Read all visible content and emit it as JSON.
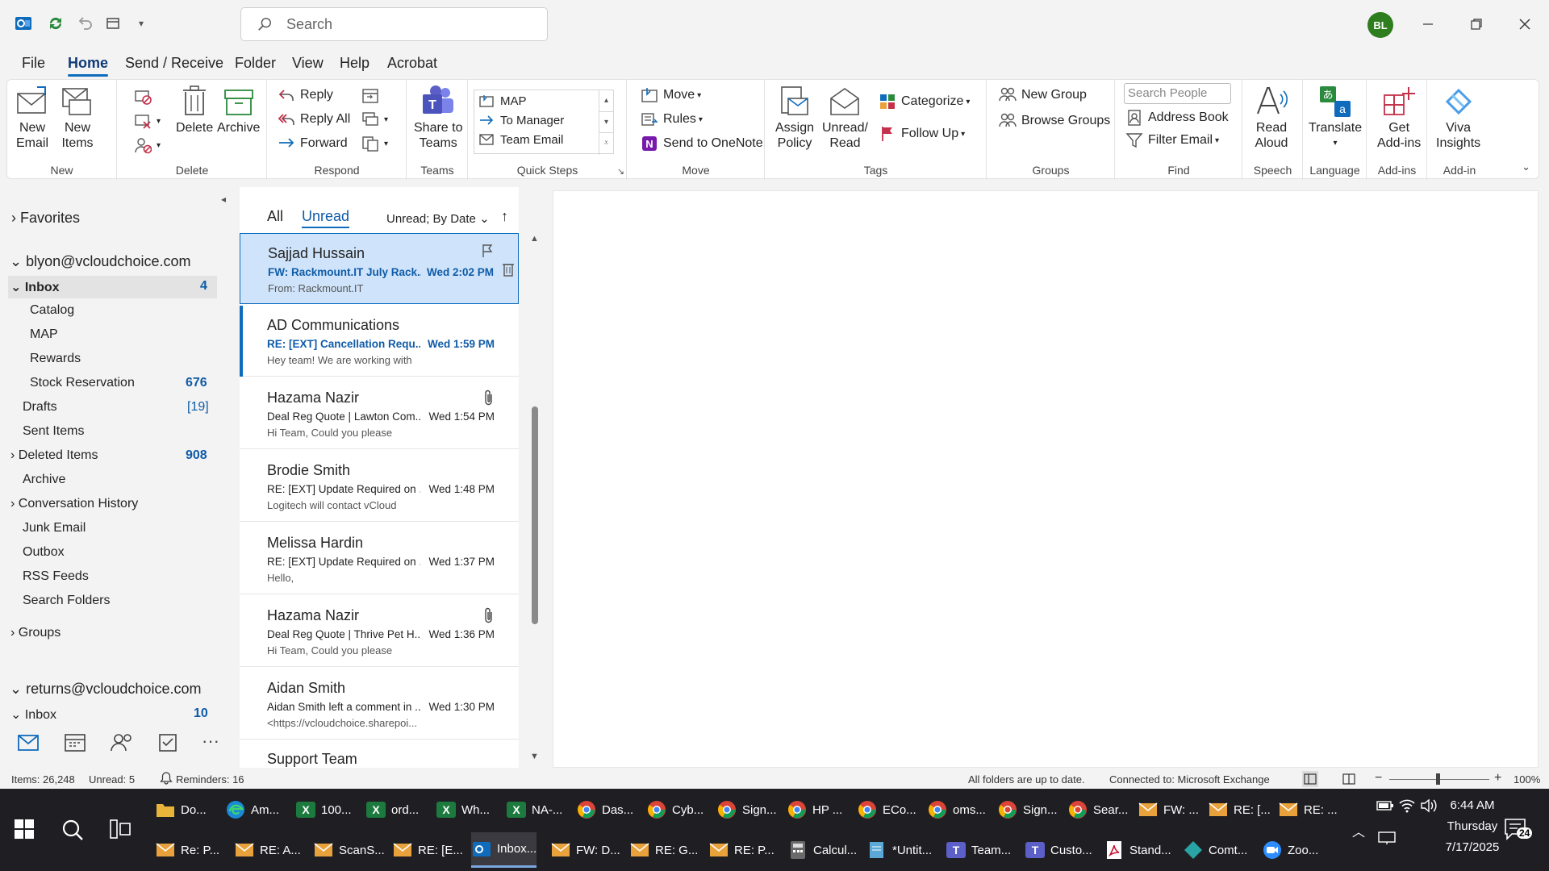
{
  "title_bar": {
    "search_placeholder": "Search",
    "avatar_initials": "BL"
  },
  "menu_tabs": [
    "File",
    "Home",
    "Send / Receive",
    "Folder",
    "View",
    "Help",
    "Acrobat"
  ],
  "ribbon": {
    "new": {
      "new_email": "New\nEmail",
      "new_items": "New\nItems",
      "label": "New"
    },
    "delete": {
      "delete": "Delete",
      "archive": "Archive",
      "label": "Delete"
    },
    "respond": {
      "reply": "Reply",
      "reply_all": "Reply All",
      "forward": "Forward",
      "label": "Respond"
    },
    "teams": {
      "share": "Share to\nTeams",
      "label": "Teams"
    },
    "quick_steps": {
      "items": [
        "MAP",
        "To Manager",
        "Team Email"
      ],
      "label": "Quick Steps"
    },
    "move": {
      "move": "Move",
      "rules": "Rules",
      "onenote": "Send to OneNote",
      "label": "Move"
    },
    "tags": {
      "assign_policy": "Assign\nPolicy",
      "unread_read": "Unread/\nRead",
      "categorize": "Categorize",
      "follow_up": "Follow Up",
      "label": "Tags"
    },
    "groups": {
      "new_group": "New Group",
      "browse_groups": "Browse Groups",
      "label": "Groups"
    },
    "find": {
      "search_people": "Search People",
      "address_book": "Address Book",
      "filter_email": "Filter Email",
      "label": "Find"
    },
    "speech": {
      "read_aloud": "Read\nAloud",
      "label": "Speech"
    },
    "language": {
      "translate": "Translate",
      "label": "Language"
    },
    "addins": {
      "get_addins": "Get\nAdd-ins",
      "label": "Add-ins"
    },
    "addin": {
      "viva": "Viva\nInsights",
      "label": "Add-in"
    }
  },
  "nav": {
    "favorites": "Favorites",
    "account1": "blyon@vcloudchoice.com",
    "folders": [
      {
        "name": "Inbox",
        "count": "4"
      },
      {
        "name": "Catalog",
        "count": ""
      },
      {
        "name": "MAP",
        "count": ""
      },
      {
        "name": "Rewards",
        "count": ""
      },
      {
        "name": "Stock Reservation",
        "count": "676"
      },
      {
        "name": "Drafts",
        "count": "[19]"
      },
      {
        "name": "Sent Items",
        "count": ""
      },
      {
        "name": "Deleted Items",
        "count": "908"
      },
      {
        "name": "Archive",
        "count": ""
      },
      {
        "name": "Conversation History",
        "count": ""
      },
      {
        "name": "Junk Email",
        "count": ""
      },
      {
        "name": "Outbox",
        "count": ""
      },
      {
        "name": "RSS Feeds",
        "count": ""
      },
      {
        "name": "Search Folders",
        "count": ""
      }
    ],
    "groups": "Groups",
    "account2": "returns@vcloudchoice.com",
    "inbox2": {
      "name": "Inbox",
      "count": "10"
    }
  },
  "list": {
    "tab_all": "All",
    "tab_unread": "Unread",
    "sort": "Unread; By Date",
    "messages": [
      {
        "from": "Sajjad Hussain",
        "subject": "FW: Rackmount.IT July Rack...",
        "time": "Wed 2:02 PM",
        "preview": "From: Rackmount.IT"
      },
      {
        "from": "AD Communications",
        "subject": "RE: [EXT] Cancellation Requ...",
        "time": "Wed 1:59 PM",
        "preview": "Hey team!  We are working with"
      },
      {
        "from": "Hazama Nazir",
        "subject": "Deal Reg Quote |  Lawton Com...",
        "time": "Wed 1:54 PM",
        "preview": "Hi Team,  Could you please"
      },
      {
        "from": "Brodie Smith",
        "subject": "RE: [EXT] Update Required on ...",
        "time": "Wed 1:48 PM",
        "preview": "Logitech will contact vCloud"
      },
      {
        "from": "Melissa Hardin",
        "subject": "RE: [EXT] Update Required on ...",
        "time": "Wed 1:37 PM",
        "preview": "Hello,"
      },
      {
        "from": "Hazama Nazir",
        "subject": "Deal Reg Quote | Thrive Pet H...",
        "time": "Wed 1:36 PM",
        "preview": "Hi Team,  Could you please"
      },
      {
        "from": "Aidan Smith",
        "subject": "Aidan Smith left a comment in ...",
        "time": "Wed 1:30 PM",
        "preview": "<https://vcloudchoice.sharepoi..."
      },
      {
        "from": "Support Team",
        "subject": "",
        "time": "",
        "preview": ""
      }
    ]
  },
  "status": {
    "items": "Items: 26,248",
    "unread": "Unread: 5",
    "reminders": "Reminders: 16",
    "sync": "All folders are up to date.",
    "connected": "Connected to: Microsoft Exchange",
    "zoom": "100%"
  },
  "taskbar": {
    "row1": [
      {
        "label": "Do...",
        "icon": "folder",
        "color": "#e8b43a"
      },
      {
        "label": "Am...",
        "icon": "edge",
        "color": "#1b8ad6"
      },
      {
        "label": "100...",
        "icon": "X",
        "color": "#1d7a3f"
      },
      {
        "label": "ord...",
        "icon": "X",
        "color": "#1d7a3f"
      },
      {
        "label": "Wh...",
        "icon": "X",
        "color": "#1d7a3f"
      },
      {
        "label": "NA-...",
        "icon": "X",
        "color": "#1d7a3f"
      },
      {
        "label": "Das...",
        "icon": "chrome",
        "color": "#4285f4"
      },
      {
        "label": "Cyb...",
        "icon": "chrome",
        "color": "#4285f4"
      },
      {
        "label": "Sign...",
        "icon": "chrome",
        "color": "#4285f4"
      },
      {
        "label": "HP ...",
        "icon": "chrome",
        "color": "#4285f4"
      },
      {
        "label": "ECo...",
        "icon": "chrome",
        "color": "#4285f4"
      },
      {
        "label": "oms...",
        "icon": "chrome",
        "color": "#4285f4"
      },
      {
        "label": "Sign...",
        "icon": "chrome",
        "color": "#db4437"
      },
      {
        "label": "Sear...",
        "icon": "chrome",
        "color": "#db4437"
      },
      {
        "label": "FW: ...",
        "icon": "mail",
        "color": "#e9a23b"
      },
      {
        "label": "RE: [...",
        "icon": "mail",
        "color": "#e9a23b"
      },
      {
        "label": "RE: ...",
        "icon": "mail",
        "color": "#e9a23b"
      }
    ],
    "row2": [
      {
        "label": "Re: P...",
        "icon": "mail",
        "color": "#e9a23b"
      },
      {
        "label": "RE: A...",
        "icon": "mail",
        "color": "#e9a23b"
      },
      {
        "label": "ScanS...",
        "icon": "mail",
        "color": "#e9a23b"
      },
      {
        "label": "RE: [E...",
        "icon": "mail",
        "color": "#e9a23b"
      },
      {
        "label": "Inbox...",
        "icon": "outlook",
        "color": "#0f6cbd"
      },
      {
        "label": "FW: D...",
        "icon": "mail",
        "color": "#e9a23b"
      },
      {
        "label": "RE: G...",
        "icon": "mail",
        "color": "#e9a23b"
      },
      {
        "label": "RE: P...",
        "icon": "mail",
        "color": "#e9a23b"
      },
      {
        "label": "Calcul...",
        "icon": "calc",
        "color": "#6a6a6a"
      },
      {
        "label": "*Untit...",
        "icon": "notepad",
        "color": "#5aa7d8"
      },
      {
        "label": "Team...",
        "icon": "T",
        "color": "#5b5fc7"
      },
      {
        "label": "Custo...",
        "icon": "T",
        "color": "#5b5fc7"
      },
      {
        "label": "Stand...",
        "icon": "pdf",
        "color": "#c8102e"
      },
      {
        "label": "Comt...",
        "icon": "diamond",
        "color": "#29a3a3"
      },
      {
        "label": "Zoo...",
        "icon": "zoom",
        "color": "#2d8cff"
      }
    ],
    "clock": {
      "time": "6:44 AM",
      "day": "Thursday",
      "date": "7/17/2025"
    },
    "notifications": "24"
  }
}
